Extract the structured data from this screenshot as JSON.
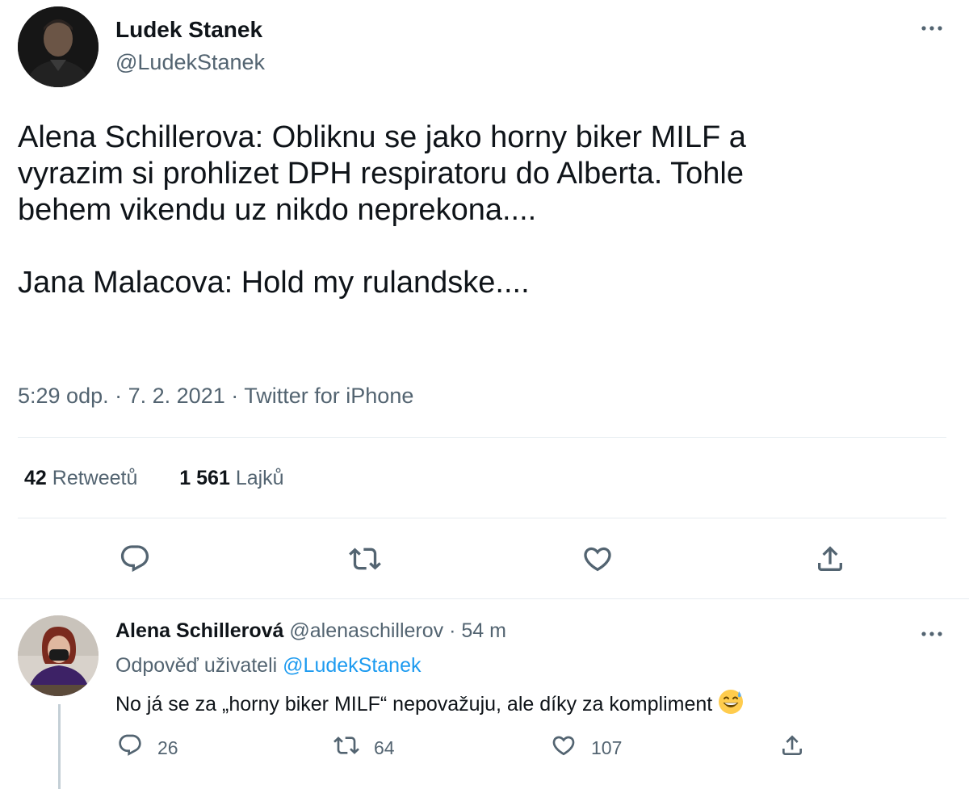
{
  "tweet": {
    "author_name": "Ludek Stanek",
    "author_handle": "@LudekStanek",
    "more_icon": "more-horizontal-icon",
    "text": "Alena Schillerova: Obliknu se jako horny biker MILF a\nvyrazim si prohlizet DPH respiratoru do Alberta. Tohle\nbehem vikendu uz nikdo neprekona....\n\nJana Malacova: Hold my rulandske....",
    "time": "5:29 odp.",
    "date": "7. 2. 2021",
    "source": "Twitter for iPhone",
    "retweets_count": "42",
    "retweets_label": "Retweetů",
    "likes_count": "1 561",
    "likes_label": "Lajků",
    "actions": [
      "reply-icon",
      "retweet-icon",
      "like-icon",
      "share-icon"
    ]
  },
  "reply": {
    "author_name": "Alena Schillerová",
    "author_handle": "@alenaschillerov",
    "age": "54 m",
    "replying_prefix": "Odpověď uživateli",
    "replying_to": "@LudekStanek",
    "text": "No já se za „horny biker MILF“ nepovažuju, ale díky za kompliment",
    "emoji": "grinning-sweat-emoji",
    "reply_count": "26",
    "retweet_count": "64",
    "like_count": "107"
  },
  "colors": {
    "text": "#0f1419",
    "secondary": "#536471",
    "link": "#1d9bf0",
    "divider": "#e6ecf0"
  }
}
